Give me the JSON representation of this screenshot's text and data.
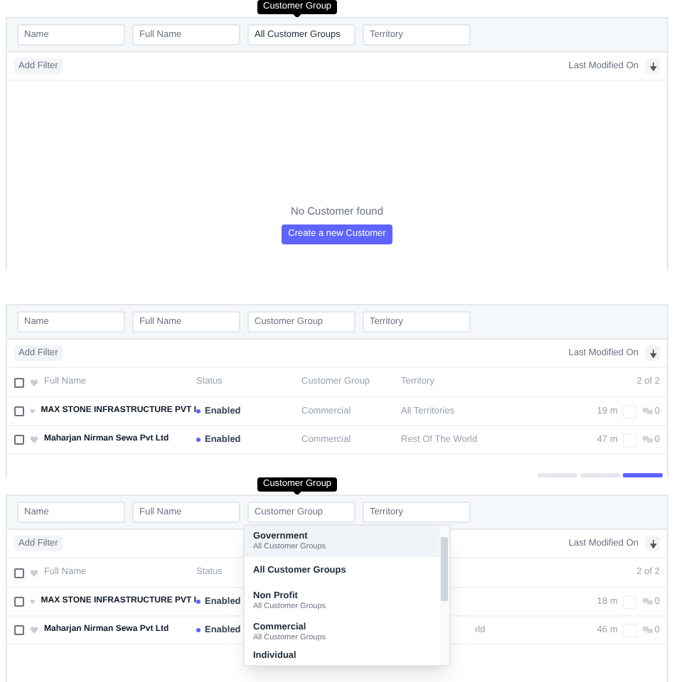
{
  "panels": [
    {
      "tooltip": "Customer Group",
      "filters": [
        {
          "placeholder": "Name"
        },
        {
          "placeholder": "Full Name"
        },
        {
          "value": "All Customer Groups"
        },
        {
          "placeholder": "Territory"
        }
      ],
      "add_filter": "Add Filter",
      "sort_label": "Last Modified On",
      "empty": {
        "message": "No Customer found",
        "button": "Create a new Customer"
      }
    },
    {
      "filters": [
        {
          "placeholder": "Name"
        },
        {
          "placeholder": "Full Name"
        },
        {
          "placeholder": "Customer Group"
        },
        {
          "placeholder": "Territory"
        }
      ],
      "add_filter": "Add Filter",
      "sort_label": "Last Modified On",
      "columns": [
        "Full Name",
        "Status",
        "Customer Group",
        "Territory"
      ],
      "count": "2 of 2",
      "select_all_checked": false,
      "rows": [
        {
          "name": "MAX STONE INFRASTRUCTURE PVT I",
          "status": "Enabled",
          "group": "Commercial",
          "territory": "All Territories",
          "modified": "19 m",
          "comments": "0",
          "checked": false
        },
        {
          "name": "Maharjan Nirman Sewa Pvt Ltd",
          "status": "Enabled",
          "group": "Commercial",
          "territory": "Rest Of The World",
          "modified": "47 m",
          "comments": "0",
          "checked": false
        }
      ],
      "paging": [
        {
          "selected": false
        },
        {
          "selected": false
        },
        {
          "selected": true
        }
      ]
    },
    {
      "tooltip": "Customer Group",
      "filters": [
        {
          "placeholder": "Name"
        },
        {
          "placeholder": "Full Name"
        },
        {
          "placeholder": "Customer Group"
        },
        {
          "placeholder": "Territory"
        }
      ],
      "add_filter": "Add Filter",
      "sort_label": "Last Modified On",
      "columns": [
        "Full Name",
        "Status"
      ],
      "count": "2 of 2",
      "select_all_checked": false,
      "rows": [
        {
          "name": "MAX STONE INFRASTRUCTURE PVT I",
          "status": "Enabled",
          "modified": "18 m",
          "comments": "0",
          "checked": false
        },
        {
          "name": "Maharjan Nirman Sewa Pvt Ltd",
          "status": "Enabled",
          "territory": "rld",
          "modified": "46 m",
          "comments": "0",
          "checked": false
        }
      ],
      "dropdown": [
        {
          "title": "Government",
          "subtitle": "All Customer Groups",
          "selected": true
        },
        {
          "title": "All Customer Groups",
          "selected": false
        },
        {
          "title": "Non Profit",
          "subtitle": "All Customer Groups",
          "selected": false
        },
        {
          "title": "Commercial",
          "subtitle": "All Customer Groups",
          "selected": false
        },
        {
          "title": "Individual",
          "selected": false
        }
      ]
    }
  ]
}
